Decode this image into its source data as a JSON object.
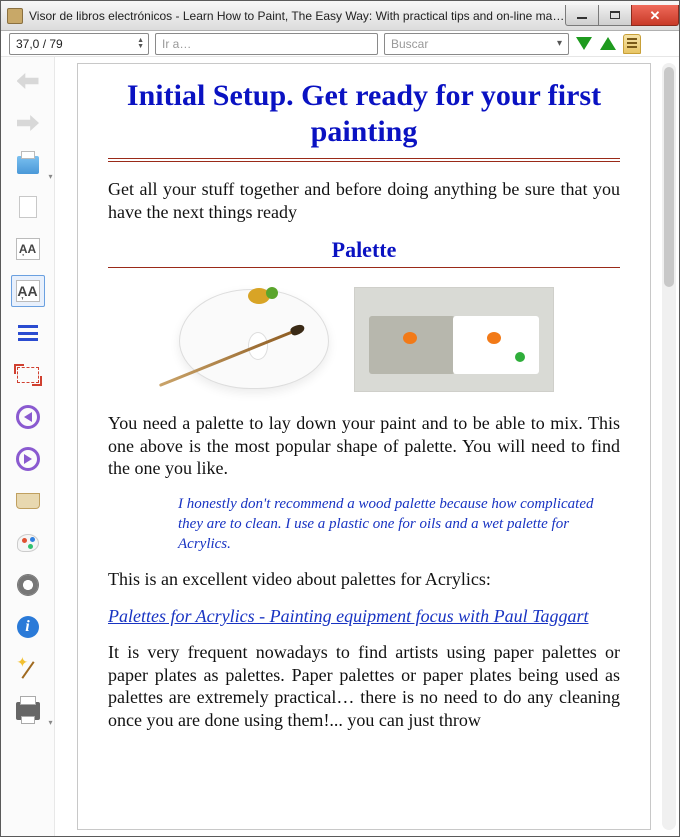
{
  "window": {
    "title": "Visor de libros electrónicos - Learn How to Paint, The Easy Way: With practical tips and on-line material [K..."
  },
  "toolbar": {
    "page_display": "37,0 / 79",
    "goto_placeholder": "Ir a…",
    "search_placeholder": "Buscar"
  },
  "content": {
    "h1": "Initial Setup. Get ready for your first painting",
    "intro": "Get all your stuff together and before doing anything be sure that you have the next things ready",
    "h2": "Palette",
    "p1": "You need a palette to lay down your paint and to be able to mix. This one above is the most popular shape of palette. You will need to find the one you like.",
    "note": "I honestly don't recommend a wood palette because how complicated they are to clean. I use a plastic one for oils and a wet palette for Acrylics.",
    "p2": "This is an excellent video about palettes for Acrylics:",
    "link": "Palettes for Acrylics - Painting equipment focus with Paul Taggart",
    "p3": "It is very frequent nowadays to find artists using paper palettes or paper plates as palettes. Paper palettes or paper plates being used as palettes are extremely practical… there is no need to do any cleaning once you are done using them!... you can just throw"
  },
  "side_aa_small": "A͎A",
  "side_aa_big": "A͎A",
  "info_glyph": "i"
}
